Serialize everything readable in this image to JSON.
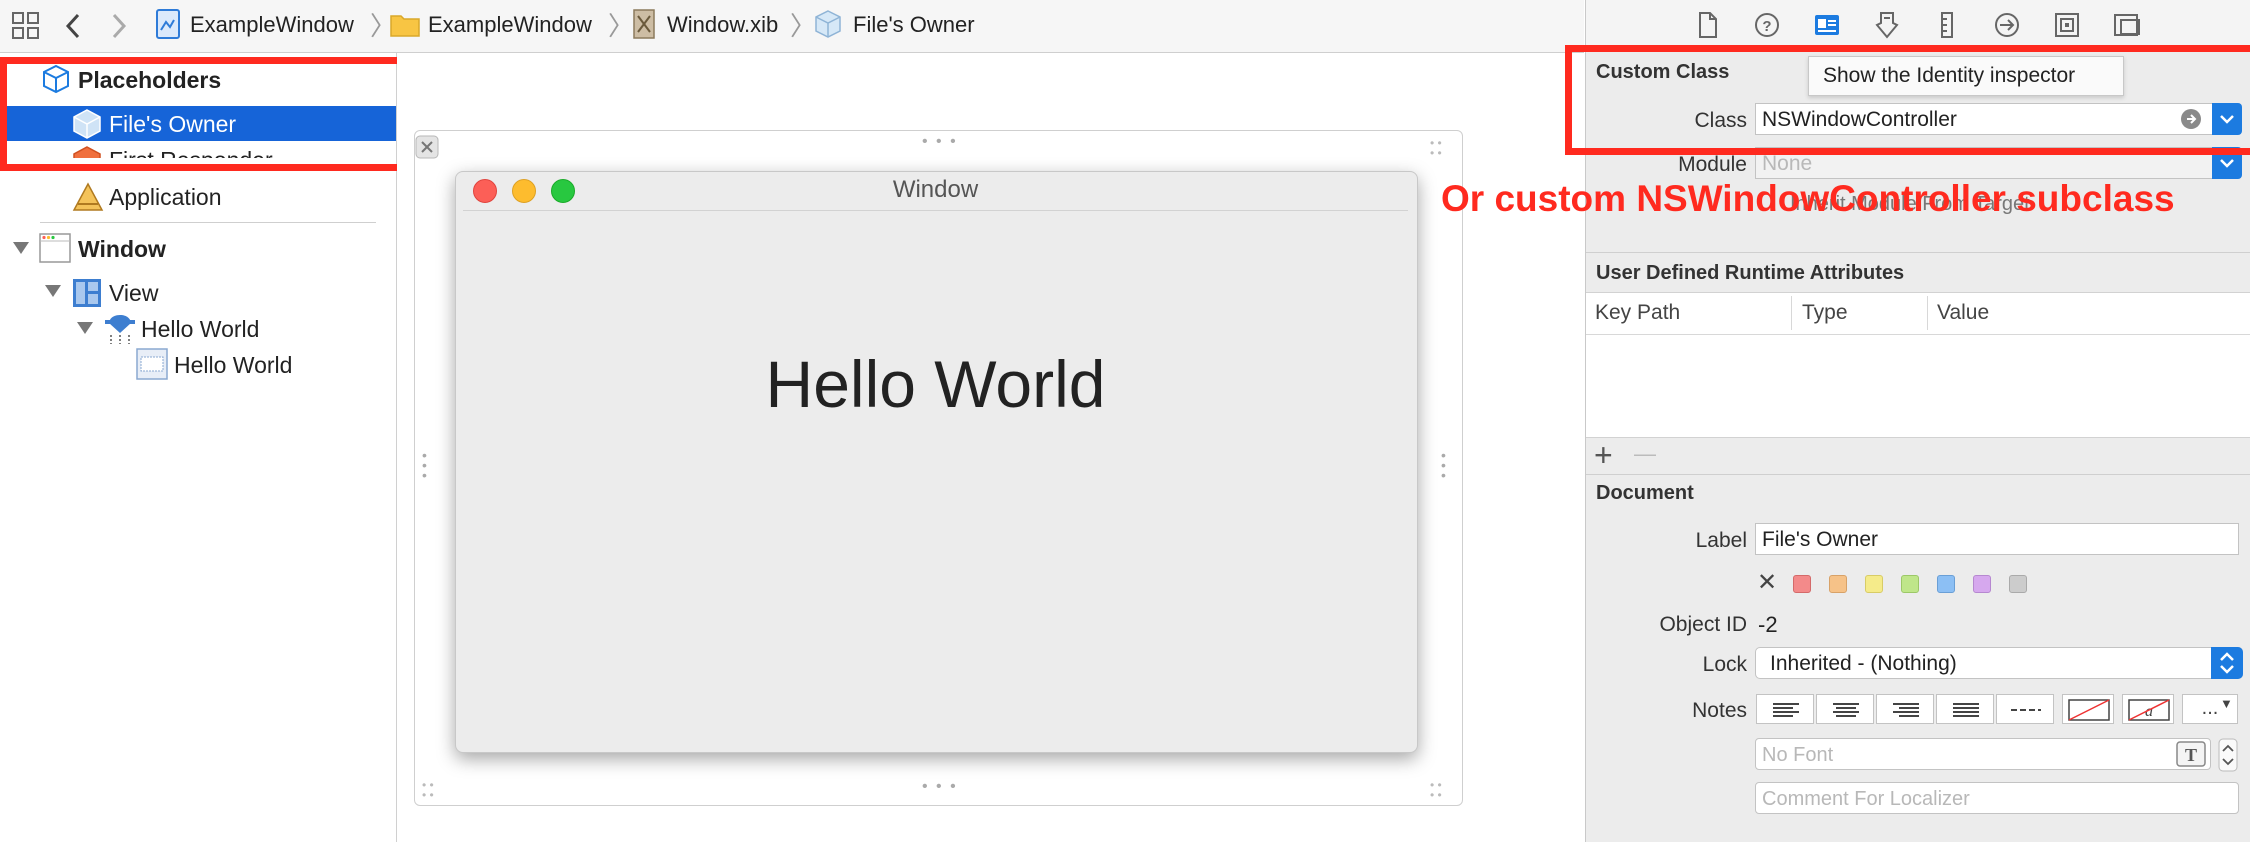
{
  "jumpbar": {
    "crumbs": [
      "ExampleWindow",
      "ExampleWindow",
      "Window.xib",
      "File's Owner"
    ]
  },
  "outline": {
    "placeholders_title": "Placeholders",
    "files_owner": "File's Owner",
    "first_responder": "First Responder",
    "application": "Application",
    "window": "Window",
    "view": "View",
    "hello_world_1": "Hello World",
    "hello_world_2": "Hello World"
  },
  "canvas": {
    "window_title": "Window",
    "label_text": "Hello World"
  },
  "inspector": {
    "tooltip": "Show the Identity inspector",
    "custom_class": {
      "title": "Custom Class",
      "class_label": "Class",
      "class_value": "NSWindowController",
      "module_label": "Module",
      "module_placeholder": "None",
      "inherit_text": "Inherit Module From Target"
    },
    "annotation": "Or custom NSWindowController subclass",
    "runtime_attrs": {
      "title": "User Defined Runtime Attributes",
      "columns": [
        "Key Path",
        "Type",
        "Value"
      ],
      "add": "+",
      "remove": "—"
    },
    "document": {
      "title": "Document",
      "label_label": "Label",
      "label_value": "File's Owner",
      "object_id_label": "Object ID",
      "object_id_value": "-2",
      "lock_label": "Lock",
      "lock_value": "Inherited - (Nothing)",
      "notes_label": "Notes",
      "more": "...",
      "font_placeholder": "No Font",
      "comment_placeholder": "Comment For Localizer"
    }
  },
  "colors": {
    "selection": "#1664d8",
    "annotation_red": "#ff2a1f",
    "traffic_red": "#fc5f57",
    "traffic_yellow": "#fdbc2e",
    "traffic_green": "#28c840"
  }
}
